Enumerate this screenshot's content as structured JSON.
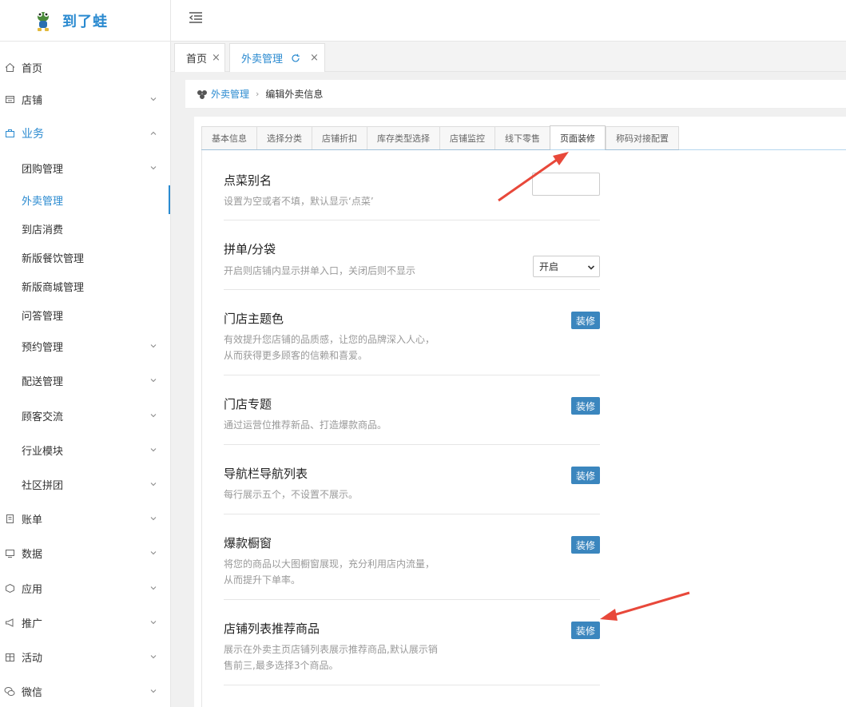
{
  "app": {
    "logo_text": "到了蛙"
  },
  "sidebar": {
    "items": [
      {
        "label": "首页",
        "icon": "home-icon"
      },
      {
        "label": "店铺",
        "icon": "store-icon"
      },
      {
        "label": "业务",
        "icon": "business-icon"
      },
      {
        "label": "团购管理"
      },
      {
        "label": "外卖管理"
      },
      {
        "label": "到店消费"
      },
      {
        "label": "新版餐饮管理"
      },
      {
        "label": "新版商城管理"
      },
      {
        "label": "问答管理"
      },
      {
        "label": "预约管理"
      },
      {
        "label": "配送管理"
      },
      {
        "label": "顾客交流"
      },
      {
        "label": "行业模块"
      },
      {
        "label": "社区拼团"
      },
      {
        "label": "账单",
        "icon": "bill-icon"
      },
      {
        "label": "数据",
        "icon": "data-icon"
      },
      {
        "label": "应用",
        "icon": "app-icon"
      },
      {
        "label": "推广",
        "icon": "promote-icon"
      },
      {
        "label": "活动",
        "icon": "activity-icon"
      },
      {
        "label": "微信",
        "icon": "wechat-icon"
      }
    ]
  },
  "page_tabs": [
    {
      "label": "首页",
      "close": "×"
    },
    {
      "label": "外卖管理",
      "close": "×"
    }
  ],
  "breadcrumb": {
    "parent": "外卖管理",
    "current": "编辑外卖信息"
  },
  "form_tabs": [
    "基本信息",
    "选择分类",
    "店铺折扣",
    "库存类型选择",
    "店铺监控",
    "线下零售",
    "页面装修",
    "称码对接配置"
  ],
  "active_form_tab": "页面装修",
  "settings": [
    {
      "title": "点菜别名",
      "desc": "设置为空或者不填，默认显示‘点菜’",
      "input_value": ""
    },
    {
      "title": "拼单/分袋",
      "desc": "开启则店铺内显示拼单入口，关闭后则不显示",
      "select_value": "开启"
    },
    {
      "title": "门店主题色",
      "desc1": "有效提升您店铺的品质感，让您的品牌深入人心，",
      "desc2": "从而获得更多顾客的信赖和喜爱。",
      "button": "装修"
    },
    {
      "title": "门店专题",
      "desc": "通过运营位推荐新品、打造爆款商品。",
      "button": "装修"
    },
    {
      "title": "导航栏导航列表",
      "desc": "每行展示五个，不设置不展示。",
      "button": "装修"
    },
    {
      "title": "爆款橱窗",
      "desc1": "将您的商品以大图橱窗展现，充分利用店内流量，",
      "desc2": "从而提升下单率。",
      "button": "装修"
    },
    {
      "title": "店铺列表推荐商品",
      "desc1": "展示在外卖主页店铺列表展示推荐商品,默认展示销",
      "desc2": "售前三,最多选择3个商品。",
      "button": "装修"
    }
  ],
  "colors": {
    "accent": "#2a8ad0",
    "button": "#3b86be",
    "annotation_arrow": "#e8483a"
  }
}
